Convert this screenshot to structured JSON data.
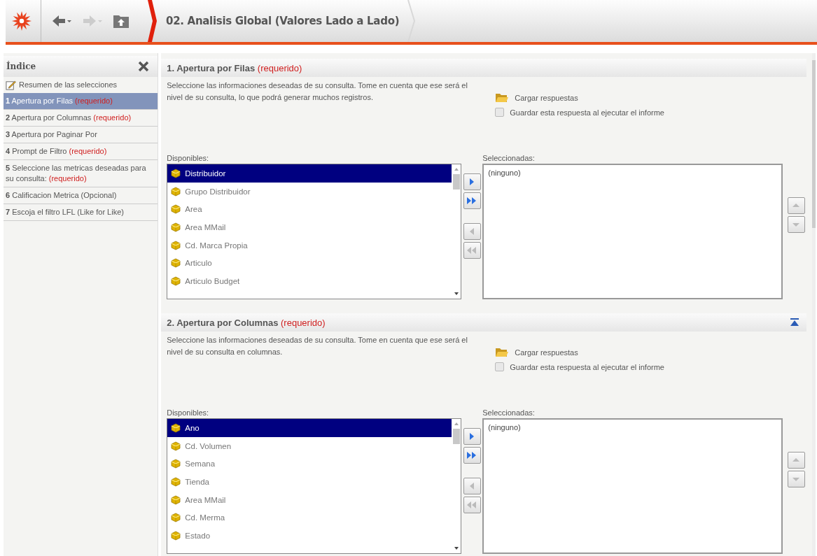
{
  "toolbar": {
    "title": "02. Analisis Global (Valores Lado a Lado)"
  },
  "sidebar": {
    "title": "Índice",
    "items": [
      {
        "kind": "summary",
        "label": "Resumen de las selecciones",
        "selected": false
      },
      {
        "kind": "step",
        "number": "1",
        "label": "Apertura por Filas",
        "tag": "(requerido)",
        "selected": true
      },
      {
        "kind": "step",
        "number": "2",
        "label": "Apertura por Columnas",
        "tag": "(requerido)",
        "selected": false
      },
      {
        "kind": "step",
        "number": "3",
        "label": "Apertura por Paginar Por",
        "selected": false
      },
      {
        "kind": "step",
        "number": "4",
        "label": "Prompt de Filtro",
        "tag": "(requerido)",
        "selected": false
      },
      {
        "kind": "step",
        "number": "5",
        "label": "Seleccione las metricas deseadas para su consulta:",
        "tag": "(requerido)",
        "selected": false
      },
      {
        "kind": "step",
        "number": "6",
        "label": "Calificacion Metrica (Opcional)",
        "selected": false
      },
      {
        "kind": "step",
        "number": "7",
        "label": "Escoja el filtro LFL (Like for Like)",
        "selected": false
      }
    ]
  },
  "sections": [
    {
      "number": "1.",
      "title": "Apertura por Filas",
      "tag": "(requerido)",
      "collapse_button": false,
      "description": "Seleccione las informaciones deseadas de su consulta. Tome en cuenta que ese será el nivel de su consulta, lo que podrá generar muchos registros.",
      "load": "Cargar respuestas",
      "save": {
        "label": "Guardar esta respuesta al ejecutar el informe",
        "checked": false
      },
      "available_label": "Disponibles:",
      "available": [
        {
          "label": "Distribuidor",
          "selected": true
        },
        {
          "label": "Grupo Distribuidor",
          "selected": false
        },
        {
          "label": "Area",
          "selected": false
        },
        {
          "label": "Area MMail",
          "selected": false
        },
        {
          "label": "Cd. Marca Propia",
          "selected": false
        },
        {
          "label": "Articulo",
          "selected": false
        },
        {
          "label": "Articulo Budget",
          "selected": false
        }
      ],
      "selected_label": "Seleccionadas:",
      "selected_items": [
        "(ninguno)"
      ]
    },
    {
      "number": "2.",
      "title": "Apertura por Columnas",
      "tag": "(requerido)",
      "collapse_button": true,
      "description": "Seleccione las informaciones deseadas de su consulta. Tome en cuenta que ese será el nivel de su consulta en columnas.",
      "load": "Cargar respuestas",
      "save": {
        "label": "Guardar esta respuesta al ejecutar el informe",
        "checked": false
      },
      "available_label": "Disponibles:",
      "available": [
        {
          "label": "Ano",
          "selected": true
        },
        {
          "label": "Cd. Volumen",
          "selected": false
        },
        {
          "label": "Semana",
          "selected": false
        },
        {
          "label": "Tienda",
          "selected": false
        },
        {
          "label": "Area MMail",
          "selected": false
        },
        {
          "label": "Cd. Merma",
          "selected": false
        },
        {
          "label": "Estado",
          "selected": false
        }
      ],
      "selected_label": "Seleccionadas:",
      "selected_items": [
        "(ninguno)"
      ]
    }
  ]
}
